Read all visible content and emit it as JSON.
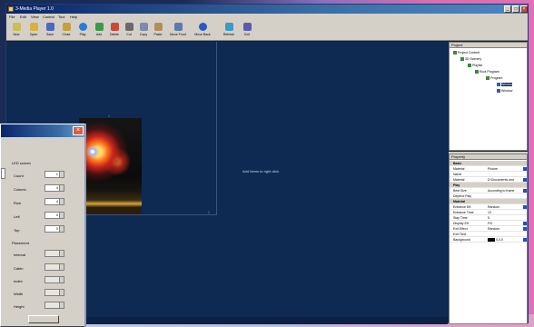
{
  "window": {
    "title": "3-Media Player 1.0"
  },
  "menu": [
    "File",
    "Edit",
    "View",
    "Control",
    "Tool",
    "Help"
  ],
  "toolbar": [
    {
      "label": "New",
      "icon": "new-file-icon",
      "color": "#c8c050"
    },
    {
      "label": "Open",
      "icon": "open-folder-icon",
      "color": "#d8b040"
    },
    {
      "label": "Save",
      "icon": "save-icon",
      "color": "#4a6ac0"
    },
    {
      "label": "Close",
      "icon": "close-file-icon",
      "color": "#c8a040"
    },
    {
      "label": "Play",
      "icon": "play-icon",
      "color": "#2a7ad8"
    },
    {
      "label": "Add",
      "icon": "add-icon",
      "color": "#3a9a4a"
    },
    {
      "label": "Delete",
      "icon": "delete-icon",
      "color": "#c84a3a"
    },
    {
      "label": "Cut",
      "icon": "cut-icon",
      "color": "#6a6a6a"
    },
    {
      "label": "Copy",
      "icon": "copy-icon",
      "color": "#7a8ab0"
    },
    {
      "label": "Paste",
      "icon": "paste-icon",
      "color": "#b0905a"
    },
    {
      "label": "Move Front",
      "icon": "move-front-icon",
      "color": "#5a7ab0"
    },
    {
      "label": "Move Back",
      "icon": "move-back-icon",
      "color": "#2a5ac0"
    },
    {
      "label": "Refresh",
      "icon": "refresh-icon",
      "color": "#3a9ac8"
    },
    {
      "label": "Exit",
      "icon": "exit-icon",
      "color": "#5a5ab0"
    }
  ],
  "canvas": {
    "center_label": "Add Items to right click",
    "top_tag": "1",
    "corner_tag": "2"
  },
  "project_pane": {
    "header": "Project",
    "tree": [
      {
        "label": "Project Content"
      },
      {
        "label": "3D Scenery"
      },
      {
        "label": "Playlist"
      },
      {
        "label": "Root Program"
      },
      {
        "label": "Program"
      },
      {
        "label": "Window",
        "selected": true
      },
      {
        "label": "Window"
      }
    ]
  },
  "properties_pane": {
    "header": "Property",
    "rows": [
      {
        "group": true,
        "key": "Basic"
      },
      {
        "key": "Material",
        "value": "Picture"
      },
      {
        "key": "Name",
        "value": ""
      },
      {
        "key": "Material",
        "value": "D:\\Documents and"
      },
      {
        "group": true,
        "key": "Play"
      },
      {
        "key": "Best Size",
        "value": "According to frame"
      },
      {
        "key": "Depend Play",
        "value": ""
      },
      {
        "group": true,
        "key": "Material"
      },
      {
        "key": "Entrance Eff.",
        "value": "Random"
      },
      {
        "key": "Entrance Time",
        "value": "10"
      },
      {
        "key": "Stay Time",
        "value": "5"
      },
      {
        "key": "Display Eff.",
        "value": "Fill"
      },
      {
        "key": "Exit Effect",
        "value": "Random"
      },
      {
        "key": "Exit Time",
        "value": ""
      },
      {
        "key": "Background",
        "value": "0,0,0"
      }
    ]
  },
  "dialog": {
    "title": "",
    "section1": "LED screen",
    "fields": [
      {
        "label": "Count",
        "value": "1"
      },
      {
        "label": "Column",
        "value": "4"
      },
      {
        "label": "Row",
        "value": "4"
      },
      {
        "label": "Left",
        "value": "0"
      },
      {
        "label": "Top",
        "value": "0"
      }
    ],
    "section2": "Placement",
    "fields2": [
      {
        "label": "Interval",
        "value": ""
      },
      {
        "label": "Cabin",
        "value": ""
      },
      {
        "label": "Index",
        "value": ""
      },
      {
        "label": "Width",
        "value": ""
      },
      {
        "label": "Height",
        "value": ""
      }
    ]
  },
  "colors": {
    "workspace": "#0e2a52",
    "titlebar": "#0a246a",
    "chrome": "#d4d0c8",
    "selection": "#0a246a"
  }
}
